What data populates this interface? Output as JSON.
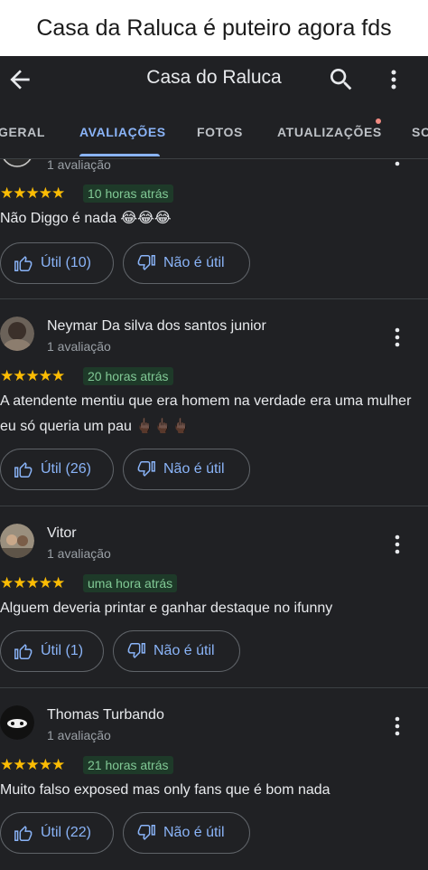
{
  "caption": "Casa da Raluca é puteiro agora fds",
  "appbar": {
    "title": "Casa do Raluca",
    "back_icon": "arrow-left-icon",
    "search_icon": "search-icon",
    "more_icon": "more-vert-icon"
  },
  "tabs": [
    "GERAL",
    "AVALIAÇÕES",
    "FOTOS",
    "ATUALIZAÇÕES",
    "SO"
  ],
  "active_tab": "AVALIAÇÕES",
  "colors": {
    "background": "#202124",
    "accent": "#8ab4f8",
    "star": "#fbbc04",
    "time_badge_bg": "#1e3a29",
    "time_badge_text": "#81c995"
  },
  "stars_glyph": "★★★★★",
  "reviews": [
    {
      "author": "",
      "count": "1 avaliação",
      "rating": 5,
      "time": "10 horas atrás",
      "text": "Não Diggo é nada 😂😂😂",
      "useful": "Útil (10)",
      "not_useful": "Não é útil"
    },
    {
      "author": "Neymar Da silva dos santos junior",
      "count": "1 avaliação",
      "rating": 5,
      "time": "20 horas atrás",
      "text": "A atendente mentiu que era homem na verdade era uma mulher eu só queria um pau 🖕🏿🖕🏿🖕🏿",
      "useful": "Útil (26)",
      "not_useful": "Não é útil"
    },
    {
      "author": "Vitor",
      "count": "1 avaliação",
      "rating": 5,
      "time": "uma hora atrás",
      "text": "Alguem deveria printar e ganhar destaque no ifunny",
      "useful": "Útil (1)",
      "not_useful": "Não é útil"
    },
    {
      "author": "Thomas Turbando",
      "count": "1 avaliação",
      "rating": 5,
      "time": "21 horas atrás",
      "text": "Muito falso exposed mas only fans que é bom nada",
      "useful": "Útil (22)",
      "not_useful": "Não é útil"
    }
  ]
}
